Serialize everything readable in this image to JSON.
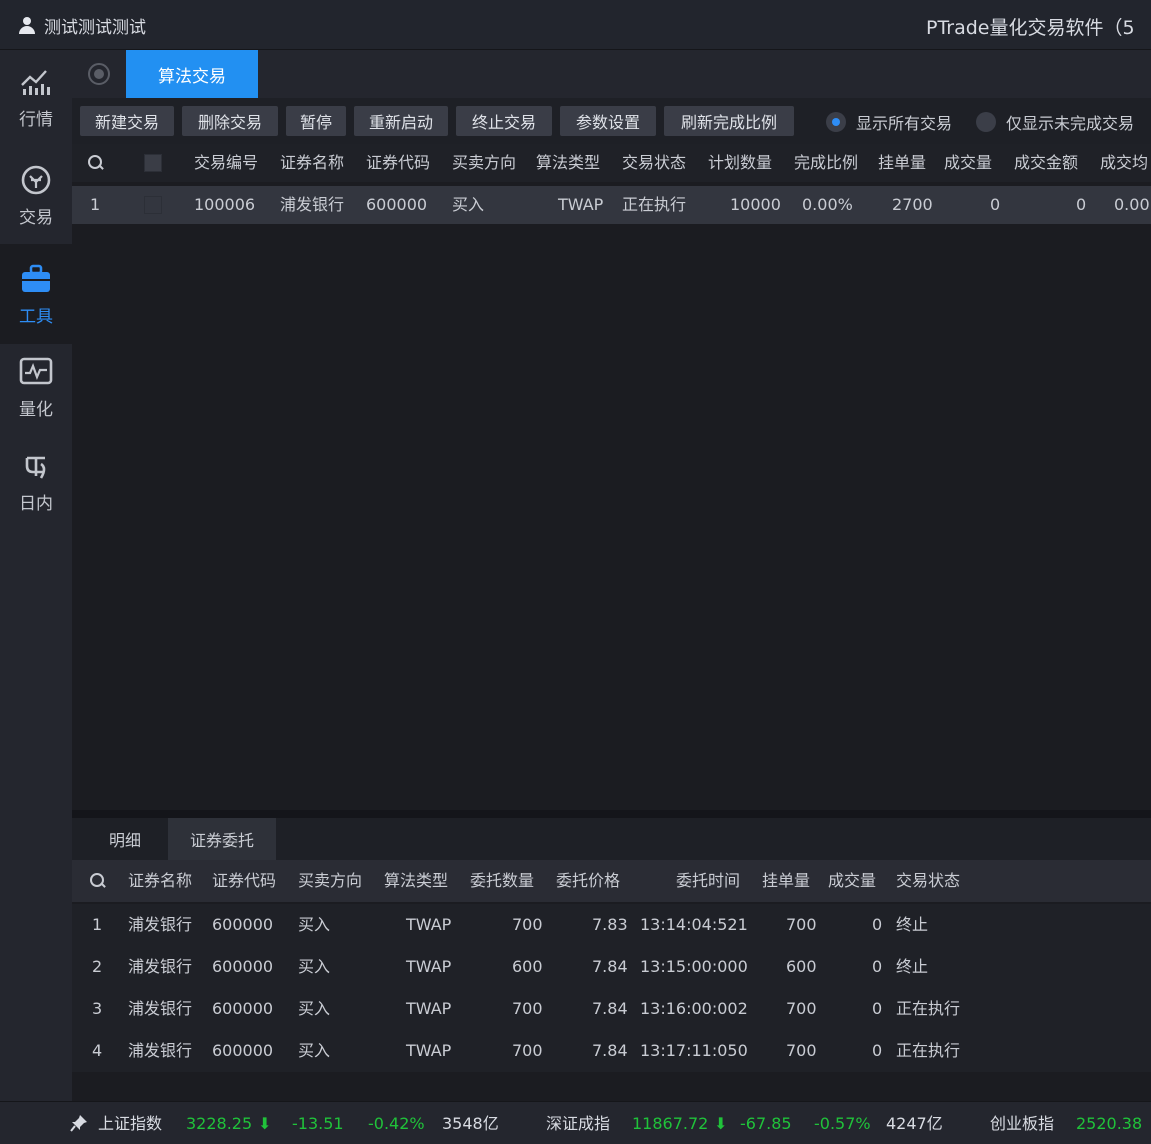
{
  "titlebar": {
    "user": "测试测试测试",
    "app_title": "PTrade量化交易软件（5"
  },
  "sidebar": {
    "items": [
      {
        "label": "行情",
        "icon": "market-chart-icon"
      },
      {
        "label": "交易",
        "icon": "trade-icon"
      },
      {
        "label": "工具",
        "icon": "toolbox-icon"
      },
      {
        "label": "量化",
        "icon": "quant-monitor-icon"
      },
      {
        "label": "日内",
        "icon": "intraday-icon"
      }
    ],
    "active": "工具"
  },
  "tabs": {
    "active_tab": "算法交易"
  },
  "toolbar": {
    "buttons": [
      "新建交易",
      "删除交易",
      "暂停",
      "重新启动",
      "终止交易",
      "参数设置",
      "刷新完成比例"
    ],
    "radio_all": "显示所有交易",
    "radio_unfinished": "仅显示未完成交易"
  },
  "algo_table": {
    "columns": [
      "交易编号",
      "证券名称",
      "证券代码",
      "买卖方向",
      "算法类型",
      "交易状态",
      "计划数量",
      "完成比例",
      "挂单量",
      "成交量",
      "成交金额",
      "成交均"
    ],
    "rows": [
      {
        "idx": "1",
        "trade_no": "100006",
        "name": "浦发银行",
        "code": "600000",
        "direction": "买入",
        "algo": "TWAP",
        "status": "正在执行",
        "plan_qty": "10000",
        "ratio": "0.00%",
        "pending": "2700",
        "filled": "0",
        "amount": "0",
        "avg": "0.00"
      }
    ]
  },
  "subtabs": {
    "items": [
      "明细",
      "证券委托"
    ],
    "active": "证券委托"
  },
  "orders_table": {
    "columns": [
      "证券名称",
      "证券代码",
      "买卖方向",
      "算法类型",
      "委托数量",
      "委托价格",
      "委托时间",
      "挂单量",
      "成交量",
      "交易状态"
    ],
    "rows": [
      {
        "idx": "1",
        "name": "浦发银行",
        "code": "600000",
        "direction": "买入",
        "algo": "TWAP",
        "qty": "700",
        "price": "7.83",
        "time": "13:14:04:521",
        "pending": "700",
        "filled": "0",
        "status": "终止"
      },
      {
        "idx": "2",
        "name": "浦发银行",
        "code": "600000",
        "direction": "买入",
        "algo": "TWAP",
        "qty": "600",
        "price": "7.84",
        "time": "13:15:00:000",
        "pending": "600",
        "filled": "0",
        "status": "终止"
      },
      {
        "idx": "3",
        "name": "浦发银行",
        "code": "600000",
        "direction": "买入",
        "algo": "TWAP",
        "qty": "700",
        "price": "7.84",
        "time": "13:16:00:002",
        "pending": "700",
        "filled": "0",
        "status": "正在执行"
      },
      {
        "idx": "4",
        "name": "浦发银行",
        "code": "600000",
        "direction": "买入",
        "algo": "TWAP",
        "qty": "700",
        "price": "7.84",
        "time": "13:17:11:050",
        "pending": "700",
        "filled": "0",
        "status": "正在执行"
      }
    ]
  },
  "statusbar": {
    "sh": {
      "name": "上证指数",
      "value": "3228.25",
      "change": "-13.51",
      "pct": "-0.42%",
      "turnover": "3548亿"
    },
    "sz": {
      "name": "深证成指",
      "value": "11867.72",
      "change": "-67.85",
      "pct": "-0.57%",
      "turnover": "4247亿"
    },
    "cy": {
      "name": "创业板指",
      "value": "2520.38"
    },
    "down_color": "#20c23a",
    "arrow": "⬇"
  }
}
